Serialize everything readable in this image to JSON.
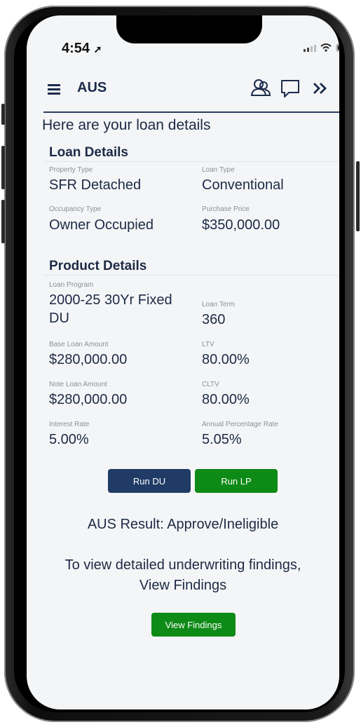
{
  "status": {
    "time": "4:54"
  },
  "appbar": {
    "title": "AUS"
  },
  "heading": "Here are your loan details",
  "loan_details": {
    "title": "Loan Details",
    "fields": [
      {
        "label": "Property Type",
        "value": "SFR Detached"
      },
      {
        "label": "Loan Type",
        "value": "Conventional"
      },
      {
        "label": "Occupancy Type",
        "value": "Owner Occupied"
      },
      {
        "label": "Purchase Price",
        "value": "$350,000.00"
      }
    ]
  },
  "product_details": {
    "title": "Product Details",
    "fields": [
      {
        "label": "Loan Program",
        "value_line1": "2000-25 30Yr Fixed",
        "value_line2": "DU"
      },
      {
        "label": "Loan Term",
        "value": "360"
      },
      {
        "label": "Base Loan Amount",
        "value": "$280,000.00"
      },
      {
        "label": "LTV",
        "value": "80.00%"
      },
      {
        "label": "Note Loan Amount",
        "value": "$280,000.00"
      },
      {
        "label": "CLTV",
        "value": "80.00%"
      },
      {
        "label": "Interest Rate",
        "value": "5.00%"
      },
      {
        "label": "Annual Percentage Rate",
        "value": "5.05%"
      }
    ]
  },
  "actions": {
    "run_du": "Run DU",
    "run_lp": "Run LP"
  },
  "result": "AUS Result: Approve/Ineligible",
  "findings": {
    "line1": "To view detailed underwriting findings,",
    "line2": "View Findings",
    "button": "View Findings"
  },
  "colors": {
    "navy": "#1f3b66",
    "green": "#0e8a16",
    "text": "#1d2a44"
  }
}
